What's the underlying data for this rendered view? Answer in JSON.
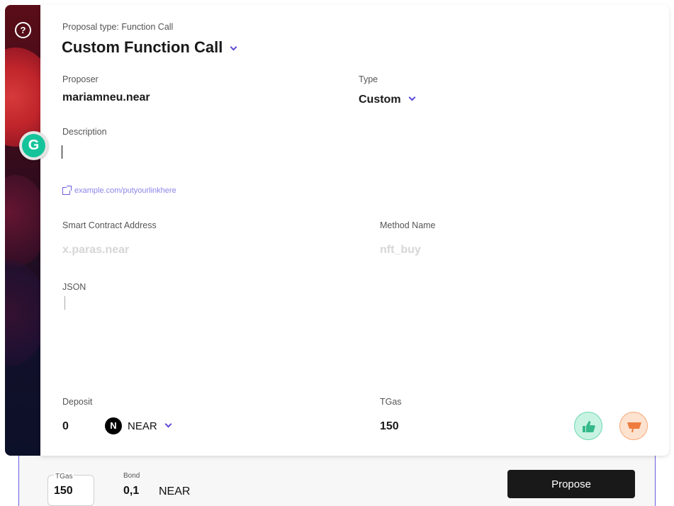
{
  "sidebar": {
    "help_icon": "question-circle-icon"
  },
  "grammarly": {
    "letter": "G"
  },
  "proposal": {
    "type_label": "Proposal type: Function Call",
    "title": "Custom Function Call"
  },
  "proposer": {
    "label": "Proposer",
    "value": "mariamneu.near"
  },
  "type": {
    "label": "Type",
    "value": "Custom"
  },
  "description": {
    "label": "Description",
    "value": ""
  },
  "link": {
    "placeholder": "example.com/putyourlinkhere",
    "icon": "external-link-icon"
  },
  "contract": {
    "label": "Smart Contract Address",
    "placeholder": "x.paras.near"
  },
  "method": {
    "label": "Method Name",
    "placeholder": "nft_buy"
  },
  "json": {
    "label": "JSON",
    "value": ""
  },
  "deposit": {
    "label": "Deposit",
    "value": "0",
    "token": "NEAR",
    "token_logo": "N"
  },
  "tgas": {
    "label": "TGas",
    "value": "150"
  },
  "votes": {
    "yes_icon": "thumbs-up-icon",
    "no_icon": "thumbs-down-icon",
    "yes_color": "#69d6ae",
    "no_color": "#f7a774"
  },
  "footer": {
    "tgas_label": "TGas",
    "tgas_value": "150",
    "bond_label": "Bond",
    "bond_value": "0,1",
    "bond_unit": "NEAR",
    "propose_label": "Propose"
  },
  "colors": {
    "accent": "#5b4ad8",
    "button": "#191919"
  }
}
